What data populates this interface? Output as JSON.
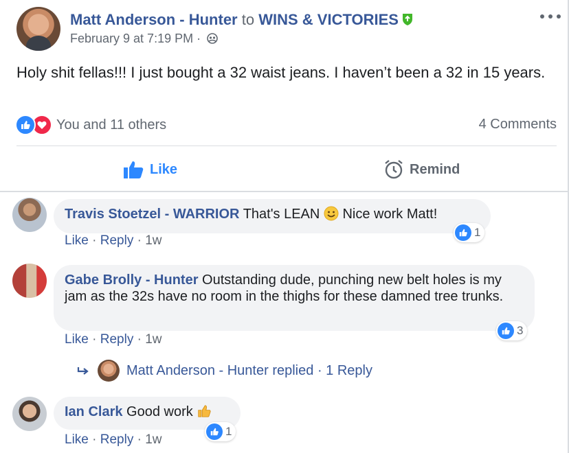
{
  "post": {
    "author": "Matt Anderson - Hunter",
    "connector": "to",
    "group": "WINS & VICTORIES",
    "timestamp": "February 9 at 7:19 PM",
    "separator": "·",
    "text": "Holy shit fellas!!! I just bought a 32 waist jeans. I haven’t been a 32 in 15 years.",
    "reactions_text": "You and 11 others",
    "comments_count": "4 Comments"
  },
  "actions": {
    "like": "Like",
    "remind": "Remind"
  },
  "comments": [
    {
      "name": "Travis Stoetzel - WARRIOR",
      "text_before": "That's LEAN",
      "text_after": " Nice work Matt!",
      "like": "Like",
      "reply": "Reply",
      "time": "1w",
      "reaction_count": "1"
    },
    {
      "name": "Gabe Brolly - Hunter",
      "text": "Outstanding dude, punching new belt holes is my jam as the 32s have no room in the thighs for these damned tree trunks.",
      "like": "Like",
      "reply": "Reply",
      "time": "1w",
      "reaction_count": "3"
    },
    {
      "name": "Ian Clark",
      "text": "Good work",
      "like": "Like",
      "reply": "Reply",
      "time": "1w",
      "reaction_count": "1"
    }
  ],
  "reply_summary": {
    "author_replied": "Matt Anderson - Hunter replied",
    "count": "1 Reply"
  },
  "colors": {
    "link": "#385898",
    "like_blue": "#2d88ff",
    "love_red": "#f0284a",
    "bubble": "#f2f3f5",
    "muted": "#606770"
  }
}
